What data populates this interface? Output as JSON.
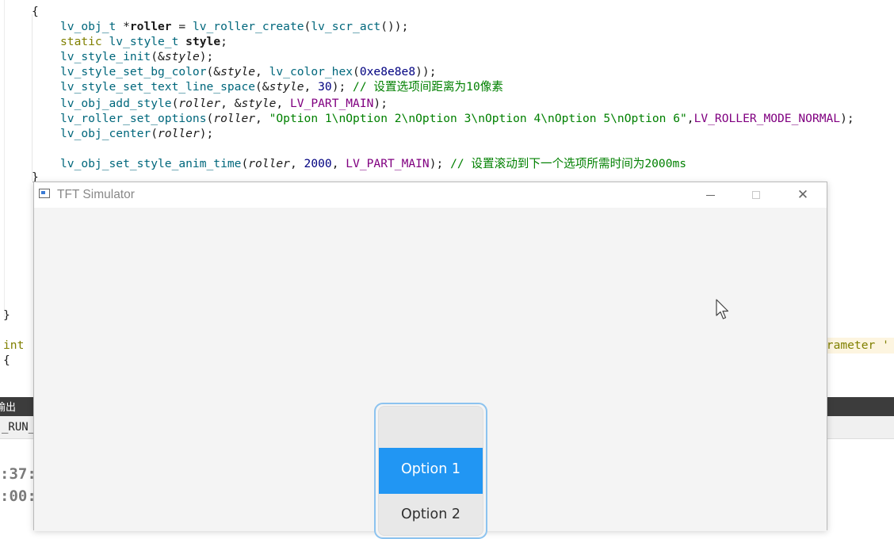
{
  "editor": {
    "lines": [
      {
        "id": "l0",
        "parts": [
          {
            "t": "{",
            "c": ""
          }
        ]
      },
      {
        "id": "l1",
        "parts": [
          {
            "t": "lv_obj_t ",
            "c": "fn"
          },
          {
            "t": "*",
            "c": ""
          },
          {
            "t": "roller",
            "c": "bold"
          },
          {
            "t": " = ",
            "c": ""
          },
          {
            "t": "lv_roller_create",
            "c": "fn"
          },
          {
            "t": "(",
            "c": ""
          },
          {
            "t": "lv_scr_act",
            "c": "fn"
          },
          {
            "t": "());",
            "c": ""
          }
        ]
      },
      {
        "id": "l2",
        "parts": [
          {
            "t": "static ",
            "c": "kw"
          },
          {
            "t": "lv_style_t ",
            "c": "fn"
          },
          {
            "t": "style",
            "c": "bold"
          },
          {
            "t": ";",
            "c": ""
          }
        ]
      },
      {
        "id": "l3",
        "parts": [
          {
            "t": "lv_style_init",
            "c": "fn"
          },
          {
            "t": "(&",
            "c": ""
          },
          {
            "t": "style",
            "c": "it"
          },
          {
            "t": ");",
            "c": ""
          }
        ]
      },
      {
        "id": "l4",
        "parts": [
          {
            "t": "lv_style_set_bg_color",
            "c": "fn"
          },
          {
            "t": "(&",
            "c": ""
          },
          {
            "t": "style",
            "c": "it"
          },
          {
            "t": ", ",
            "c": ""
          },
          {
            "t": "lv_color_hex",
            "c": "fn"
          },
          {
            "t": "(",
            "c": ""
          },
          {
            "t": "0xe8e8e8",
            "c": "num"
          },
          {
            "t": "));",
            "c": ""
          }
        ]
      },
      {
        "id": "l5",
        "parts": [
          {
            "t": "lv_style_set_text_line_space",
            "c": "fn"
          },
          {
            "t": "(&",
            "c": ""
          },
          {
            "t": "style",
            "c": "it"
          },
          {
            "t": ", ",
            "c": ""
          },
          {
            "t": "30",
            "c": "num"
          },
          {
            "t": "); ",
            "c": ""
          },
          {
            "t": "// 设置选项间距离为10像素",
            "c": "cm"
          }
        ]
      },
      {
        "id": "l6",
        "parts": [
          {
            "t": "lv_obj_add_style",
            "c": "fn"
          },
          {
            "t": "(",
            "c": ""
          },
          {
            "t": "roller",
            "c": "it"
          },
          {
            "t": ", &",
            "c": ""
          },
          {
            "t": "style",
            "c": "it"
          },
          {
            "t": ", ",
            "c": ""
          },
          {
            "t": "LV_PART_MAIN",
            "c": "macro"
          },
          {
            "t": ");",
            "c": ""
          }
        ]
      },
      {
        "id": "l7",
        "parts": [
          {
            "t": "lv_roller_set_options",
            "c": "fn"
          },
          {
            "t": "(",
            "c": ""
          },
          {
            "t": "roller",
            "c": "it"
          },
          {
            "t": ", ",
            "c": ""
          },
          {
            "t": "\"Option 1\\nOption 2\\nOption 3\\nOption 4\\nOption 5\\nOption 6\"",
            "c": "str"
          },
          {
            "t": ",",
            "c": ""
          },
          {
            "t": "LV_ROLLER_MODE_NORMAL",
            "c": "macro"
          },
          {
            "t": ");",
            "c": ""
          }
        ]
      },
      {
        "id": "l8",
        "parts": [
          {
            "t": "lv_obj_center",
            "c": "fn"
          },
          {
            "t": "(",
            "c": ""
          },
          {
            "t": "roller",
            "c": "it"
          },
          {
            "t": ");",
            "c": ""
          }
        ]
      },
      {
        "id": "l9",
        "parts": [
          {
            "t": "lv_obj_set_style_anim_time",
            "c": "fn"
          },
          {
            "t": "(",
            "c": ""
          },
          {
            "t": "roller",
            "c": "it"
          },
          {
            "t": ", ",
            "c": ""
          },
          {
            "t": "2000",
            "c": "num"
          },
          {
            "t": ", ",
            "c": ""
          },
          {
            "t": "LV_PART_MAIN",
            "c": "macro"
          },
          {
            "t": "); ",
            "c": ""
          },
          {
            "t": "// 设置滚动到下一个选项所需时间为2000ms",
            "c": "cm"
          }
        ]
      }
    ],
    "fragments": {
      "brace_close": "}",
      "brace_close2": "}",
      "int_kw": "int",
      "brace_open2": "{",
      "right_tag": "arameter '"
    }
  },
  "output_panel": {
    "title": "输出",
    "run_label": "_RUN_",
    "time1": ":37:",
    "time2": ":00:"
  },
  "simulator": {
    "title": "TFT Simulator",
    "roller": {
      "options": [
        "Option 1",
        "Option 2"
      ],
      "selected": "Option 1",
      "selected_color": "#2196f3",
      "bg_color": "#e8e8e8",
      "focus_outline_color": "#8cc3ef"
    }
  }
}
